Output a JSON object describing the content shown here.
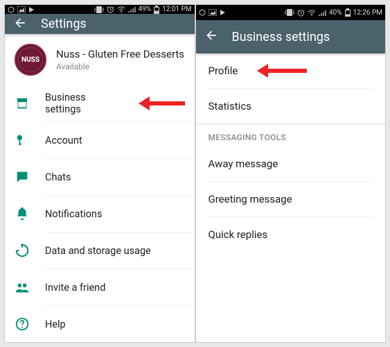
{
  "left": {
    "statusbar": {
      "battery": "49%",
      "time": "12:01 PM"
    },
    "appbar": {
      "title": "Settings"
    },
    "profile": {
      "name": "Nuss - Gluten Free Desserts",
      "status": "Available",
      "avatar_text": "NUSS"
    },
    "items": [
      {
        "label": "Business settings"
      },
      {
        "label": "Account"
      },
      {
        "label": "Chats"
      },
      {
        "label": "Notifications"
      },
      {
        "label": "Data and storage usage"
      },
      {
        "label": "Invite a friend"
      },
      {
        "label": "Help"
      }
    ]
  },
  "right": {
    "statusbar": {
      "battery": "40%",
      "time": "12:26 PM"
    },
    "appbar": {
      "title": "Business settings"
    },
    "section1": [
      {
        "label": "Profile"
      },
      {
        "label": "Statistics"
      }
    ],
    "section_header": "MESSAGING TOOLS",
    "section2": [
      {
        "label": "Away message"
      },
      {
        "label": "Greeting message"
      },
      {
        "label": "Quick replies"
      }
    ]
  }
}
